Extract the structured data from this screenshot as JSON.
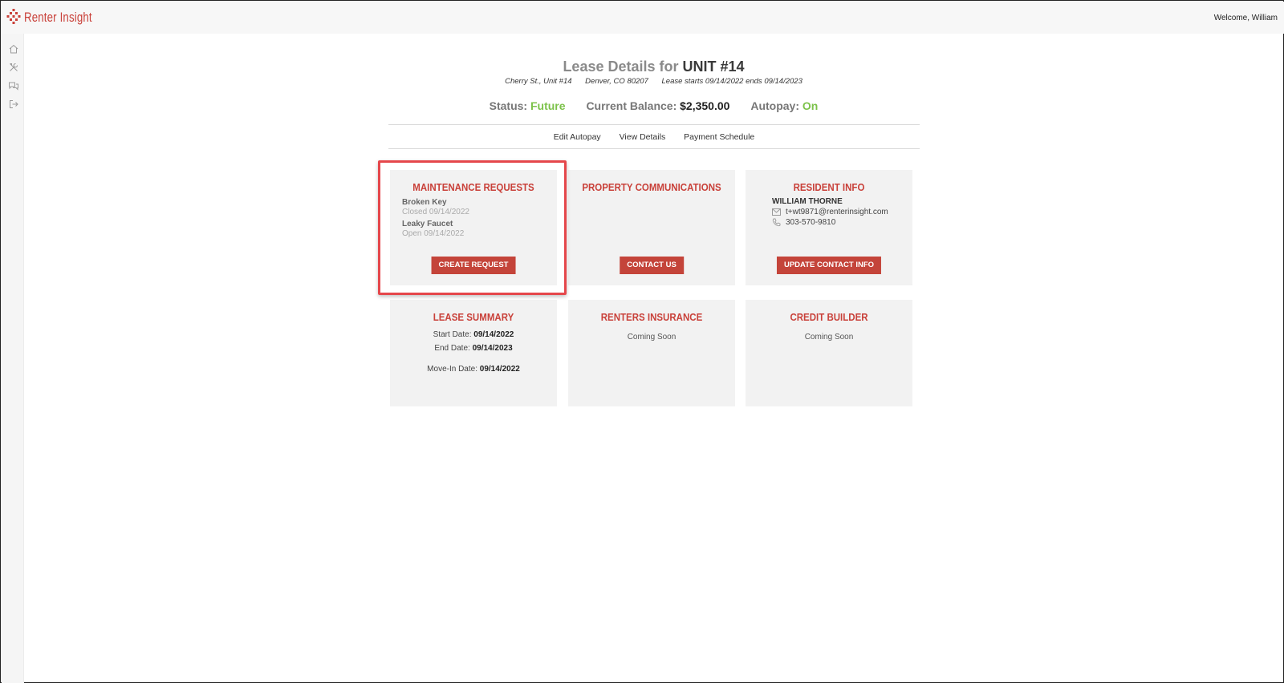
{
  "header": {
    "logo_text": "Renter Insight",
    "welcome": "Welcome, William"
  },
  "sidebar": {
    "items": [
      {
        "icon": "home-icon"
      },
      {
        "icon": "tools-icon"
      },
      {
        "icon": "chat-icon"
      },
      {
        "icon": "logout-icon"
      }
    ]
  },
  "lease": {
    "title_prefix": "Lease Details for",
    "unit": "UNIT #14",
    "address": "Cherry St., Unit #14",
    "city": "Denver, CO 80207",
    "term": "Lease starts 09/14/2022 ends 09/14/2023",
    "status_label": "Status:",
    "status_value": "Future",
    "balance_label": "Current Balance:",
    "balance_value": "$2,350.00",
    "autopay_label": "Autopay:",
    "autopay_value": "On"
  },
  "links": {
    "edit_autopay": "Edit Autopay",
    "view_details": "View Details",
    "payment_schedule": "Payment Schedule"
  },
  "cards": {
    "maintenance": {
      "title": "MAINTENANCE REQUESTS",
      "requests": [
        {
          "name": "Broken Key",
          "status": "Closed 09/14/2022"
        },
        {
          "name": "Leaky Faucet",
          "status": "Open 09/14/2022"
        }
      ],
      "button": "CREATE REQUEST"
    },
    "communications": {
      "title": "PROPERTY COMMUNICATIONS",
      "button": "CONTACT US"
    },
    "resident": {
      "title": "RESIDENT INFO",
      "name": "WILLIAM THORNE",
      "email": "t+wt9871@renterinsight.com",
      "phone": "303-570-9810",
      "button": "UPDATE CONTACT INFO"
    },
    "lease_summary": {
      "title": "LEASE SUMMARY",
      "start_label": "Start Date:",
      "start_value": "09/14/2022",
      "end_label": "End Date:",
      "end_value": "09/14/2023",
      "movein_label": "Move-In Date:",
      "movein_value": "09/14/2022"
    },
    "insurance": {
      "title": "RENTERS INSURANCE",
      "text": "Coming Soon"
    },
    "credit": {
      "title": "CREDIT BUILDER",
      "text": "Coming Soon"
    }
  },
  "colors": {
    "accent": "#c9413a",
    "positive": "#7cc24a",
    "highlight": "#e5474b"
  }
}
